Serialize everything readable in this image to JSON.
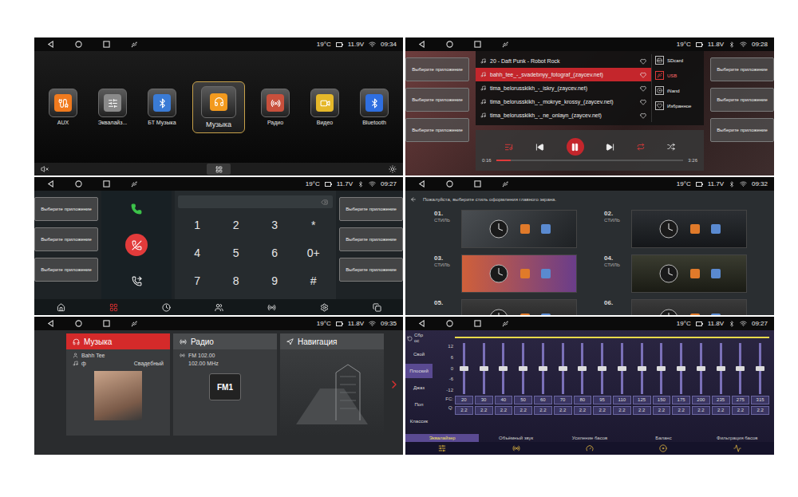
{
  "launcher": {
    "status": {
      "temperature": "19°C",
      "voltage": "11.9V",
      "bluetooth": false,
      "time": "09:34"
    },
    "apps": [
      {
        "label": "AUX",
        "selected": false,
        "color": "#f07a1e"
      },
      {
        "label": "Эквалайз...",
        "selected": false,
        "color": "#8a8a8a"
      },
      {
        "label": "БТ Музыка",
        "selected": false,
        "color": "#3a7bd5"
      },
      {
        "label": "Музыка",
        "selected": true,
        "color": "#f39a1e"
      },
      {
        "label": "Радио",
        "selected": false,
        "color": "#c8503c"
      },
      {
        "label": "Видео",
        "selected": false,
        "color": "#e5b82a"
      },
      {
        "label": "Bluetooth",
        "selected": false,
        "color": "#2f6fe0"
      }
    ]
  },
  "player": {
    "status": {
      "temperature": "19°C",
      "voltage": "11.8V",
      "bluetooth": true,
      "time": "09:28"
    },
    "sideButtonsLeft": [
      "Выберите приложение",
      "Выберите приложение",
      "Выберите приложение"
    ],
    "sideButtonsRight": [
      "Выберите приложение",
      "Выберите приложение",
      "Выберите приложение"
    ],
    "tracks": [
      {
        "title": "20 - Daft Punk - Robot Rock",
        "selected": false
      },
      {
        "title": "bahh_tee_-_svadebnyy_fotograf_(zaycev.net)",
        "selected": true
      },
      {
        "title": "tima_belorusskikh_-_iskry_(zaycev.net)",
        "selected": false
      },
      {
        "title": "tima_belorusskikh_-_mokrye_krossy_(zaycev.net)",
        "selected": false
      },
      {
        "title": "tima_belorusskikh_-_ne_onlayn_(zaycev.net)",
        "selected": false
      }
    ],
    "sources": [
      {
        "label": "SDcard",
        "selected": false
      },
      {
        "label": "USB",
        "selected": true
      },
      {
        "label": "iNand",
        "selected": false
      },
      {
        "label": "Избранное",
        "selected": false
      }
    ],
    "elapsed": "0:16",
    "duration": "3:26",
    "progress": 0.08
  },
  "phone": {
    "status": {
      "temperature": "19°C",
      "voltage": "11.7V",
      "bluetooth": true,
      "time": "09:27"
    },
    "sideButtonsLeft": [
      "Выберите приложение",
      "Выберите приложение",
      "Выберите приложение"
    ],
    "sideButtonsRight": [
      "Выберите приложение",
      "Выберите приложение",
      "Выберите приложение"
    ],
    "keys": [
      "1",
      "2",
      "3",
      "*",
      "4",
      "5",
      "6",
      "0+",
      "7",
      "8",
      "9",
      "#"
    ],
    "tabs": [
      {
        "selected": false
      },
      {
        "selected": true
      },
      {
        "selected": false
      },
      {
        "selected": false
      },
      {
        "selected": false
      },
      {
        "selected": false
      },
      {
        "selected": false
      }
    ]
  },
  "styles": {
    "status": {
      "temperature": "19°C",
      "voltage": "11.7V",
      "bluetooth": true,
      "time": "09:32"
    },
    "title": "Пожалуйста, выберите стиль оформления главного экрана.",
    "items": [
      {
        "number": "01.",
        "label": "СТИЛЬ"
      },
      {
        "number": "02.",
        "label": "СТИЛЬ"
      },
      {
        "number": "03.",
        "label": "СТИЛЬ"
      },
      {
        "number": "04.",
        "label": "СТИЛЬ"
      },
      {
        "number": "05."
      },
      {
        "number": "06."
      }
    ]
  },
  "home": {
    "status": {
      "temperature": "19°C",
      "voltage": "11.8V",
      "bluetooth": false,
      "time": "09:35"
    },
    "music": {
      "title": "Музыка",
      "selected": true,
      "artist": "Bahh Tee",
      "album": "ф",
      "track": "Свадебный"
    },
    "radio": {
      "title": "Радио",
      "selected": false,
      "station": "FM 102.00",
      "frequency": "102.00 MHz",
      "band": "FM1"
    },
    "navigation": {
      "title": "Навигация",
      "selected": false
    }
  },
  "equalizer": {
    "status": {
      "temperature": "19°C",
      "voltage": "11.8V",
      "bluetooth": true,
      "time": "09:27"
    },
    "reset": "Сброс",
    "presets": [
      {
        "label": "Свой",
        "selected": false
      },
      {
        "label": "Плоский",
        "selected": true
      },
      {
        "label": "Джаз",
        "selected": false
      },
      {
        "label": "Поп",
        "selected": false
      },
      {
        "label": "Классик",
        "selected": false
      }
    ],
    "scale": [
      "12",
      "6",
      "0",
      "-6",
      "-12"
    ],
    "fcLabel": "FC:",
    "qLabel": "Q:",
    "bands": [
      {
        "freq": "20",
        "q": "2.2",
        "level": 0.5
      },
      {
        "freq": "30",
        "q": "2.2",
        "level": 0.5
      },
      {
        "freq": "40",
        "q": "2.2",
        "level": 0.5
      },
      {
        "freq": "50",
        "q": "2.2",
        "level": 0.5
      },
      {
        "freq": "60",
        "q": "2.2",
        "level": 0.5
      },
      {
        "freq": "70",
        "q": "2.2",
        "level": 0.5
      },
      {
        "freq": "80",
        "q": "2.2",
        "level": 0.5
      },
      {
        "freq": "95",
        "q": "2.2",
        "level": 0.5
      },
      {
        "freq": "110",
        "q": "2.2",
        "level": 0.5
      },
      {
        "freq": "125",
        "q": "2.2",
        "level": 0.5
      },
      {
        "freq": "150",
        "q": "2.2",
        "level": 0.5
      },
      {
        "freq": "175",
        "q": "2.2",
        "level": 0.5
      },
      {
        "freq": "200",
        "q": "2.2",
        "level": 0.5
      },
      {
        "freq": "235",
        "q": "2.2",
        "level": 0.5
      },
      {
        "freq": "275",
        "q": "2.2",
        "level": 0.5
      },
      {
        "freq": "315",
        "q": "2.2",
        "level": 0.5
      }
    ],
    "tabs": [
      {
        "label": "Эквалайзер",
        "selected": true
      },
      {
        "label": "Объёмный звук",
        "selected": false
      },
      {
        "label": "Усиление басов",
        "selected": false
      },
      {
        "label": "Баланс",
        "selected": false
      },
      {
        "label": "Фильтрация басов",
        "selected": false
      }
    ]
  }
}
